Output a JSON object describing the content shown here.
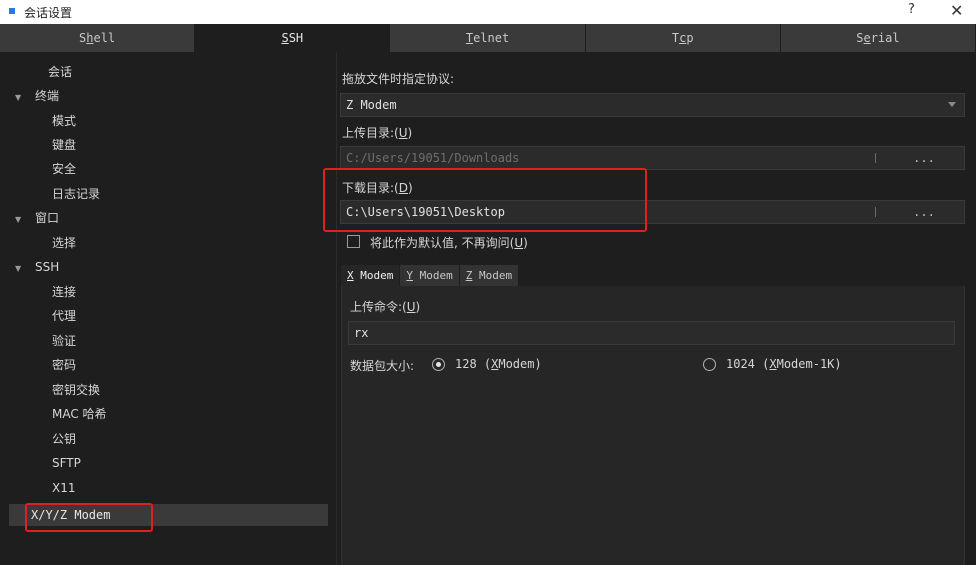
{
  "window": {
    "title": "会话设置",
    "help_label": "?",
    "close_label": "✕"
  },
  "tabs": [
    {
      "pre": "S",
      "u": "h",
      "post": "ell"
    },
    {
      "pre": "",
      "u": "S",
      "post": "SH"
    },
    {
      "pre": "",
      "u": "T",
      "post": "elnet"
    },
    {
      "pre": "T",
      "u": "c",
      "post": "p"
    },
    {
      "pre": "S",
      "u": "e",
      "post": "rial"
    }
  ],
  "tree": {
    "items": [
      {
        "label": "会话"
      },
      {
        "label": "终端",
        "arrow": "▼"
      },
      {
        "label": "模式"
      },
      {
        "label": "键盘"
      },
      {
        "label": "安全"
      },
      {
        "label": "日志记录"
      },
      {
        "label": "窗口",
        "arrow": "▼"
      },
      {
        "label": "选择"
      },
      {
        "label": "SSH",
        "arrow": "▼"
      },
      {
        "label": "连接"
      },
      {
        "label": "代理"
      },
      {
        "label": "验证"
      },
      {
        "label": "密码"
      },
      {
        "label": "密钥交换"
      },
      {
        "label": "MAC 哈希"
      },
      {
        "label": "公钥"
      },
      {
        "label": "SFTP"
      },
      {
        "label": "X11"
      },
      {
        "label": "X/Y/Z Modem"
      }
    ]
  },
  "transfer": {
    "protocol_label": "拖放文件时指定协议:",
    "protocol_value": "Z Modem",
    "upload_dir_label": "上传目录:(",
    "upload_dir_key": "U",
    "upload_dir_value": "C:/Users/19051/Downloads",
    "download_dir_label": "下载目录:(",
    "download_dir_key": "D",
    "download_dir_value": "C:\\Users\\19051\\Desktop",
    "browse_label": "...",
    "default_checkbox_label": "将此作为默认值, 不再询问(",
    "default_checkbox_key": "U",
    "close_paren": ")"
  },
  "modem_tabs": [
    {
      "u": "X",
      "post": " Modem"
    },
    {
      "u": "Y",
      "post": " Modem"
    },
    {
      "u": "Z",
      "post": " Modem"
    }
  ],
  "xmodem": {
    "upload_cmd_label": "上传命令:(",
    "upload_cmd_key": "U",
    "upload_cmd_value": "rx",
    "packet_size_label": "数据包大小:",
    "option_128_pre": "128 (",
    "option_128_key": "X",
    "option_128_post": "Modem)",
    "option_128_selected": true,
    "option_1024_pre": "1024 (",
    "option_1024_key": "X",
    "option_1024_post": "Modem-1K)"
  }
}
